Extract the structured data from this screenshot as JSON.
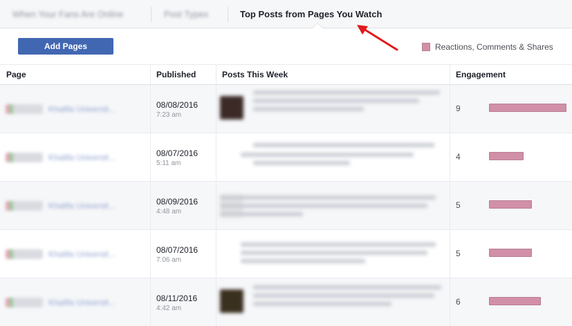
{
  "tabs": [
    {
      "label": "When Your Fans Are Online",
      "active": false
    },
    {
      "label": "Post Types",
      "active": false
    },
    {
      "label": "Top Posts from Pages You Watch",
      "active": true
    }
  ],
  "toolbar": {
    "add_pages_label": "Add Pages",
    "legend_label": "Reactions, Comments & Shares",
    "legend_color": "#d190a8"
  },
  "table": {
    "headers": {
      "page": "Page",
      "published": "Published",
      "posts": "Posts This Week",
      "engagement": "Engagement"
    },
    "rows": [
      {
        "page_name": "Khalifa Universit...",
        "date": "08/08/2016",
        "time": "7:23 am",
        "engagement": 9,
        "thumb": "#3b2a26"
      },
      {
        "page_name": "Khalifa Universit...",
        "date": "08/07/2016",
        "time": "5:11 am",
        "engagement": 4,
        "thumb": ""
      },
      {
        "page_name": "Khalifa Universit...",
        "date": "08/09/2016",
        "time": "4:48 am",
        "engagement": 5,
        "thumb": "#e3e3e3"
      },
      {
        "page_name": "Khalifa Universit...",
        "date": "08/07/2016",
        "time": "7:06 am",
        "engagement": 5,
        "thumb": ""
      },
      {
        "page_name": "Khalifa Universit...",
        "date": "08/11/2016",
        "time": "4:42 am",
        "engagement": 6,
        "thumb": "#3a3020"
      }
    ],
    "engagement_max": 9
  },
  "colors": {
    "accent": "#4267b2",
    "bar": "#d190a8",
    "annotation_arrow": "#e0191b"
  }
}
